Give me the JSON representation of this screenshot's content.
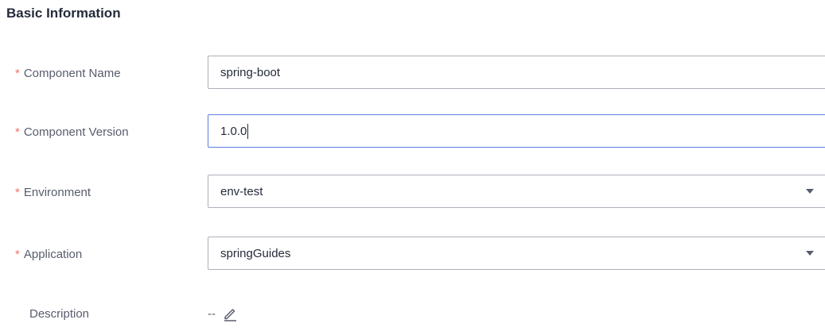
{
  "section": {
    "title": "Basic Information"
  },
  "required_mark": "*",
  "fields": {
    "component_name": {
      "label": "Component Name",
      "value": "spring-boot"
    },
    "component_version": {
      "label": "Component Version",
      "value": "1.0.0"
    },
    "environment": {
      "label": "Environment",
      "value": "env-test"
    },
    "application": {
      "label": "Application",
      "value": "springGuides"
    },
    "description": {
      "label": "Description",
      "value": "--"
    }
  },
  "icons": {
    "dropdown": "chevron-down-icon",
    "edit": "pencil-icon"
  },
  "colors": {
    "required_star": "#f66f6a",
    "focus_border": "#5e7ce0",
    "border": "#adb0b8",
    "label": "#575d6c",
    "text": "#252b3a"
  }
}
